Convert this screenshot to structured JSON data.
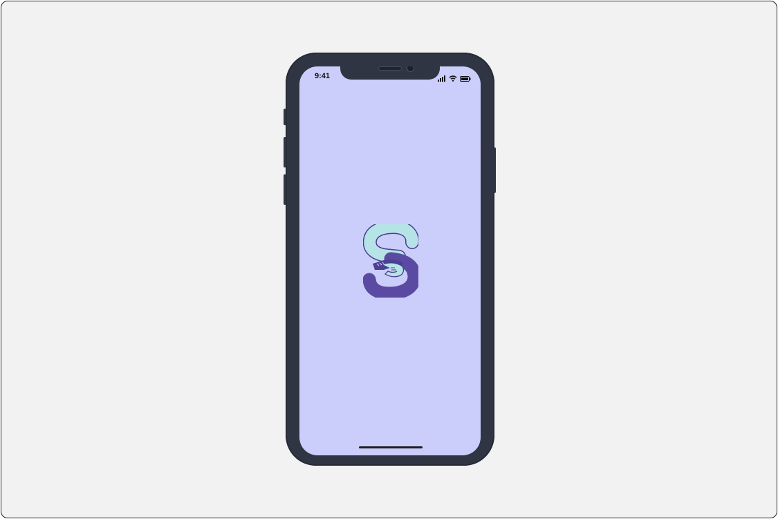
{
  "status_bar": {
    "time": "9:41",
    "icons": [
      "signal-bars-icon",
      "wifi-icon",
      "battery-icon"
    ]
  },
  "screen": {
    "background_color": "#cbcdfa",
    "logo": "handshake-s-logo"
  },
  "colors": {
    "logo_light": "#b6e4e6",
    "logo_dark": "#5a4aa1",
    "logo_outline": "#4a3d8f",
    "device_body": "#2f3542",
    "page_background": "#f2f2f2"
  }
}
